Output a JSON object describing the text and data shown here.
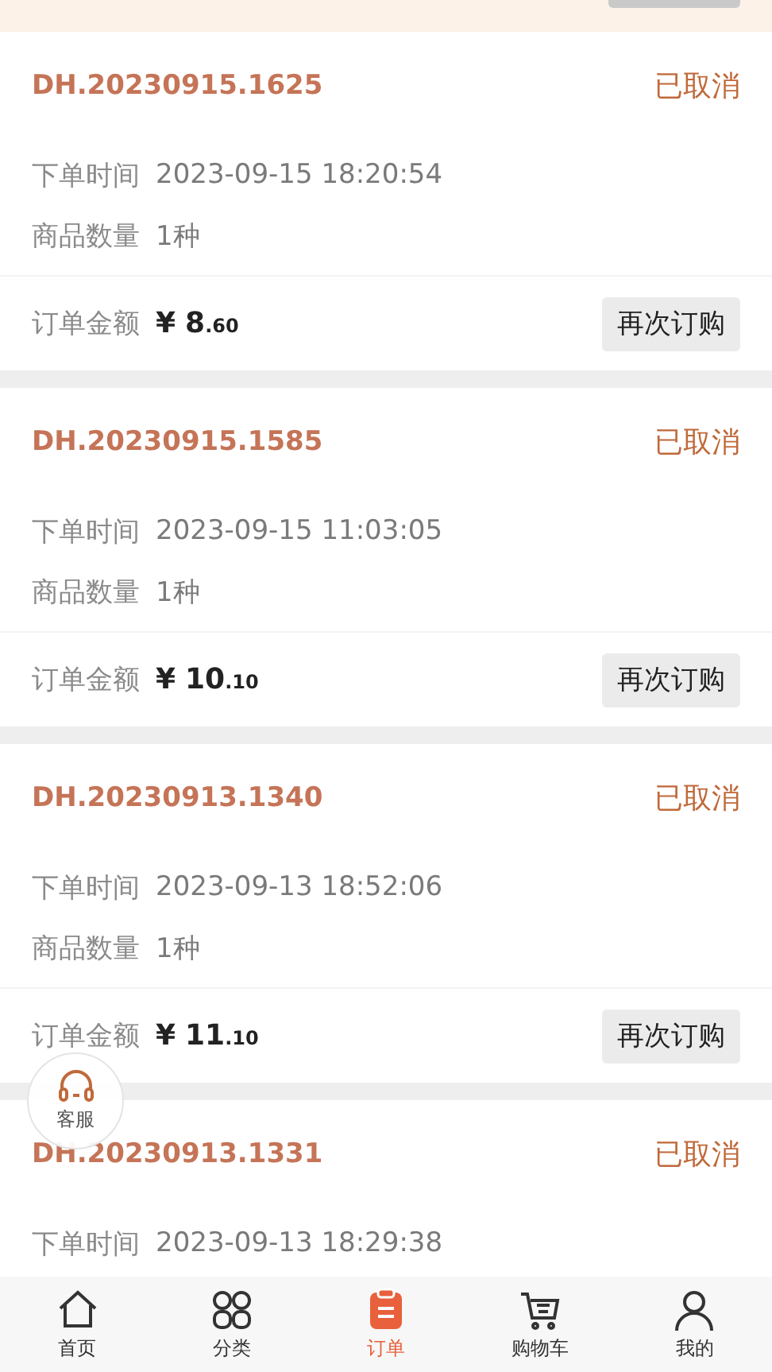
{
  "orders": [
    {
      "number": "DH.20230915.1625",
      "status": "已取消",
      "time_label": "下单时间",
      "time": "2023-09-15 18:20:54",
      "qty_label": "商品数量",
      "qty": "1种",
      "amount_label": "订单金额",
      "currency": "¥",
      "amount_int": "8",
      "amount_dec": ".60",
      "action": "再次订购"
    },
    {
      "number": "DH.20230915.1585",
      "status": "已取消",
      "time_label": "下单时间",
      "time": "2023-09-15 11:03:05",
      "qty_label": "商品数量",
      "qty": "1种",
      "amount_label": "订单金额",
      "currency": "¥",
      "amount_int": "10",
      "amount_dec": ".10",
      "action": "再次订购"
    },
    {
      "number": "DH.20230913.1340",
      "status": "已取消",
      "time_label": "下单时间",
      "time": "2023-09-13 18:52:06",
      "qty_label": "商品数量",
      "qty": "1种",
      "amount_label": "订单金额",
      "currency": "¥",
      "amount_int": "11",
      "amount_dec": ".10",
      "action": "再次订购"
    },
    {
      "number": "DH.20230913.1331",
      "status": "已取消",
      "time_label": "下单时间",
      "time": "2023-09-13 18:29:38"
    }
  ],
  "support": {
    "label": "客服"
  },
  "nav": [
    {
      "kind": "home",
      "label": "首页",
      "selected": false
    },
    {
      "kind": "category",
      "label": "分类",
      "selected": false
    },
    {
      "kind": "orders",
      "label": "订单",
      "selected": true
    },
    {
      "kind": "cart",
      "label": "购物车",
      "selected": false
    },
    {
      "kind": "me",
      "label": "我的",
      "selected": false
    }
  ]
}
